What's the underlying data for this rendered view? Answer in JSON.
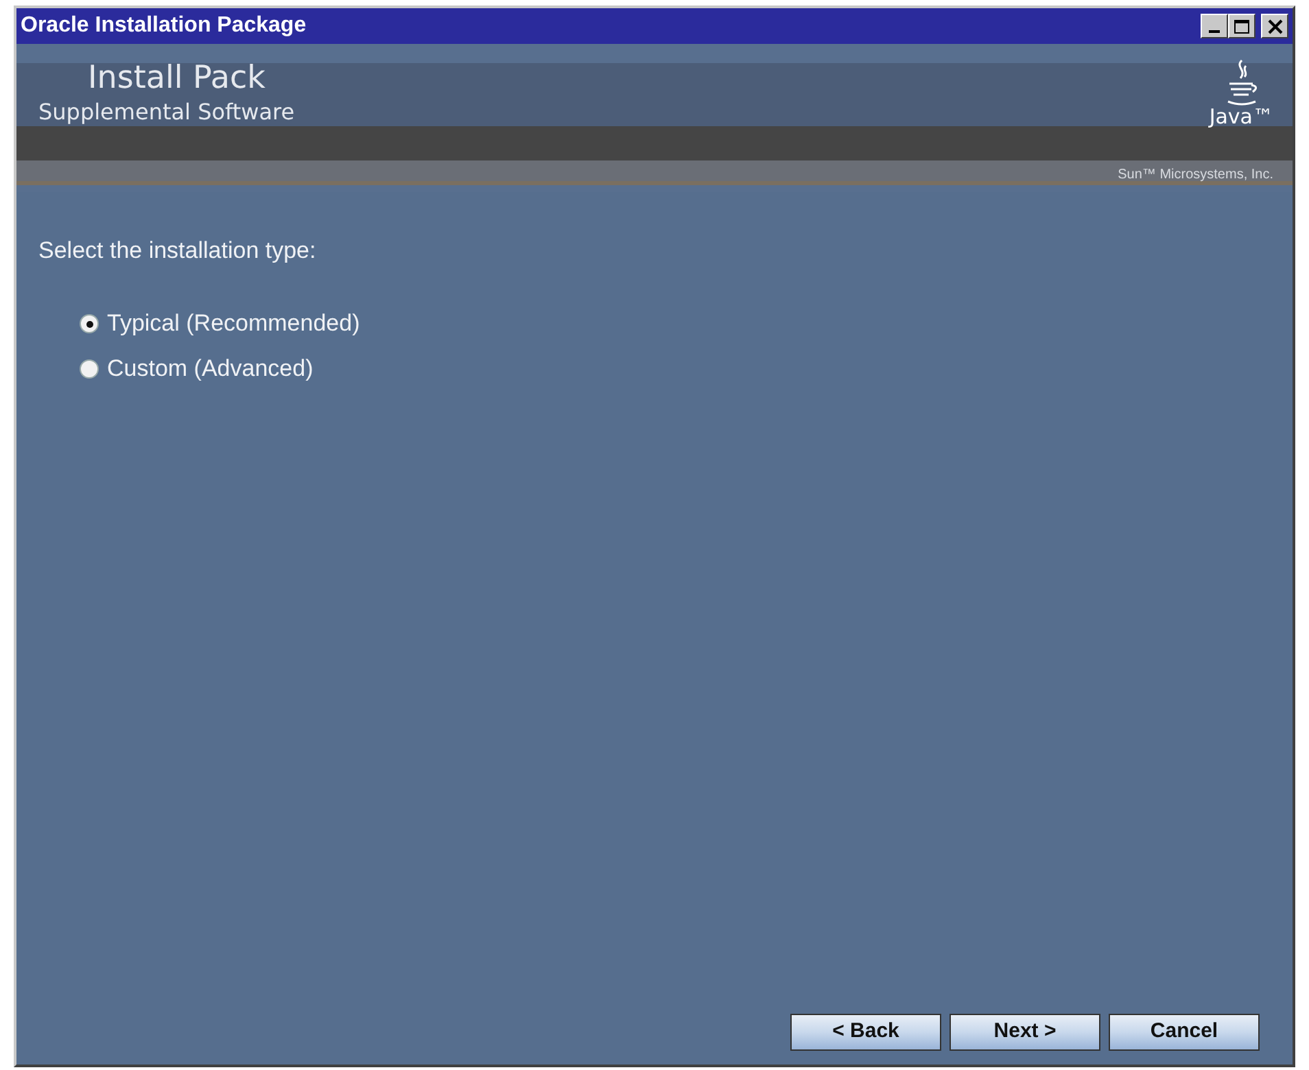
{
  "window": {
    "title": "Oracle Installation Package"
  },
  "header": {
    "title": "Install Pack",
    "subtitle": "Supplemental Software",
    "logo_text": "Java™",
    "vendor": "Sun™ Microsystems, Inc."
  },
  "prompt": "Select the installation type:",
  "options": [
    {
      "label": "Typical (Recommended)",
      "selected": true
    },
    {
      "label": "Custom (Advanced)",
      "selected": false
    }
  ],
  "buttons": [
    "< Back",
    "Next >",
    "Cancel"
  ]
}
